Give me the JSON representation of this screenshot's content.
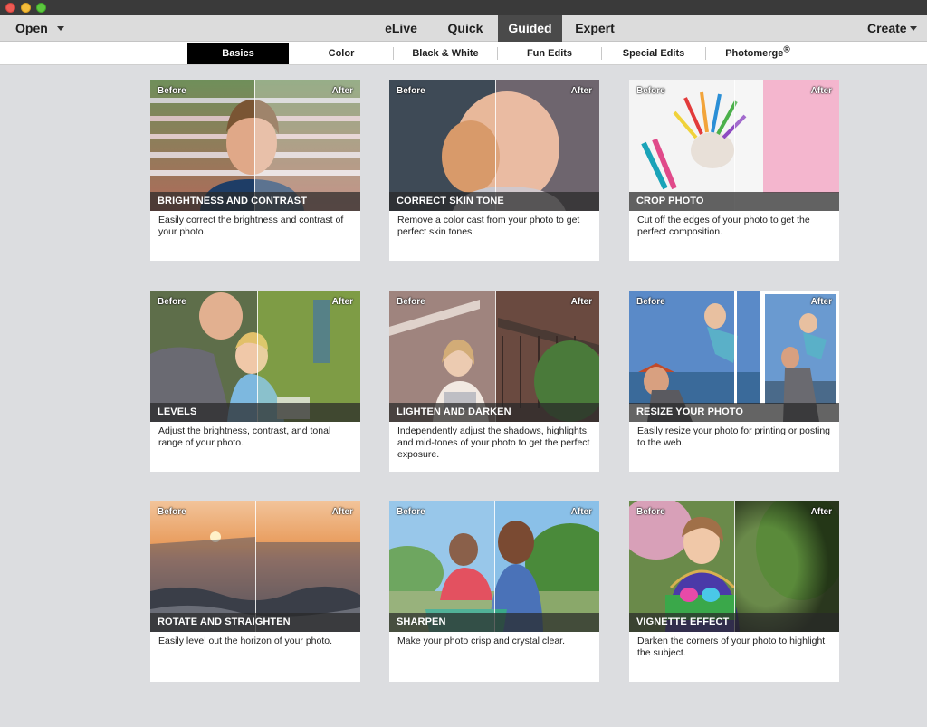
{
  "toolbar": {
    "open_label": "Open",
    "create_label": "Create",
    "modes": [
      "eLive",
      "Quick",
      "Guided",
      "Expert"
    ],
    "active_mode": "Guided"
  },
  "subtabs": {
    "items": [
      "Basics",
      "Color",
      "Black & White",
      "Fun Edits",
      "Special Edits",
      "Photomerge"
    ],
    "photomerge_mark": "®",
    "active": "Basics"
  },
  "badges": {
    "before": "Before",
    "after": "After"
  },
  "colors": {
    "accent_dark": "#4a4a4a",
    "active_subtab": "#000000",
    "background": "#dcdde0"
  },
  "cards": [
    {
      "title": "BRIGHTNESS AND CONTRAST",
      "description": "Easily correct the brightness and contrast of your photo.",
      "icon": "boy-portrait-photo"
    },
    {
      "title": "CORRECT SKIN TONE",
      "description": "Remove a color cast from your photo to get perfect skin tones.",
      "icon": "baby-portrait-photo"
    },
    {
      "title": "CROP PHOTO",
      "description": "Cut off the edges of your photo to get the perfect composition.",
      "icon": "colored-pencils-photo"
    },
    {
      "title": "LEVELS",
      "description": "Adjust the brightness, contrast, and tonal range of your photo.",
      "icon": "father-child-photo"
    },
    {
      "title": "LIGHTEN AND DARKEN",
      "description": "Independently adjust the shadows, highlights, and mid-tones of your photo to get the perfect exposure.",
      "icon": "woman-stairs-photo"
    },
    {
      "title": "RESIZE YOUR PHOTO",
      "description": "Easily resize your photo for printing or posting to the web.",
      "icon": "father-lifting-child-photo"
    },
    {
      "title": "ROTATE AND STRAIGHTEN",
      "description": "Easily level out the horizon of your photo.",
      "icon": "sunset-ocean-photo"
    },
    {
      "title": "SHARPEN",
      "description": "Make your photo crisp and crystal clear.",
      "icon": "mother-child-fountain-photo"
    },
    {
      "title": "VIGNETTE EFFECT",
      "description": "Darken the corners of your photo to highlight the subject.",
      "icon": "girl-easter-basket-photo"
    }
  ]
}
